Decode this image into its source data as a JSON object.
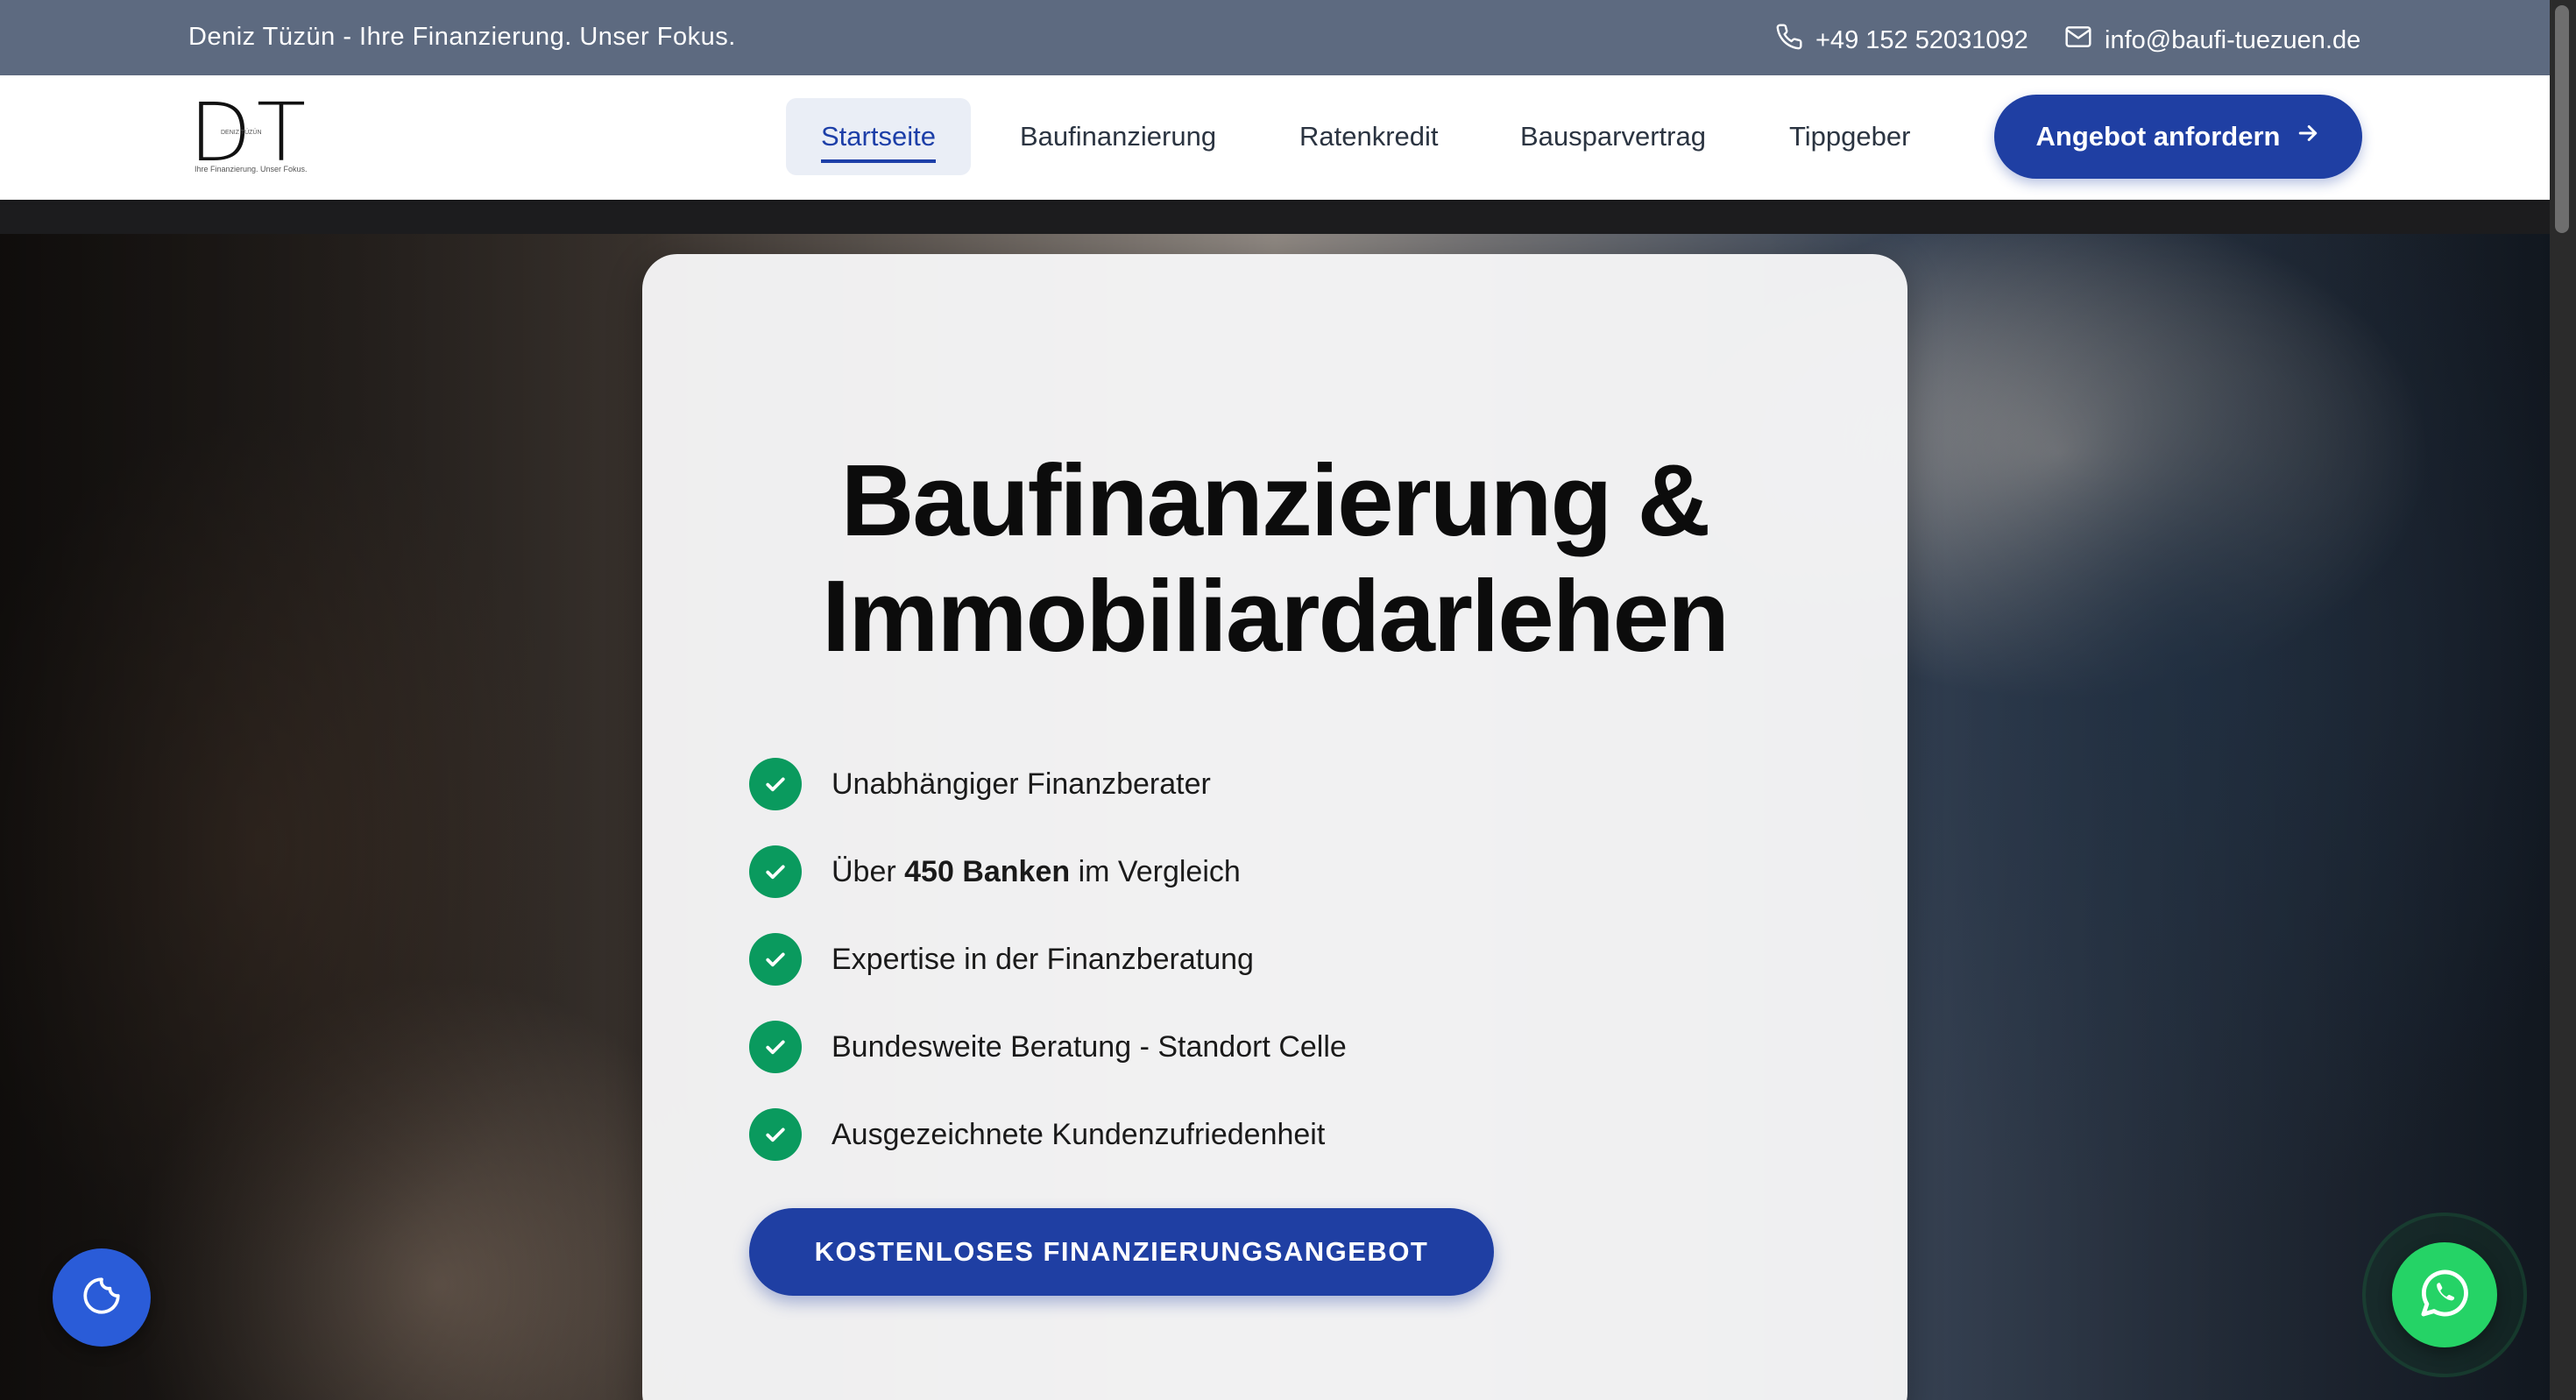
{
  "topbar": {
    "tagline": "Deniz Tüzün - Ihre Finanzierung. Unser Fokus.",
    "phone": "+49 152 52031092",
    "email": "info@baufi-tuezuen.de"
  },
  "logo": {
    "letters": "DT",
    "name": "DENIZ TÜZÜN",
    "subtitle": "Ihre Finanzierung. Unser Fokus."
  },
  "nav": {
    "items": [
      {
        "label": "Startseite",
        "active": true
      },
      {
        "label": "Baufinanzierung",
        "active": false
      },
      {
        "label": "Ratenkredit",
        "active": false
      },
      {
        "label": "Bausparvertrag",
        "active": false
      },
      {
        "label": "Tippgeber",
        "active": false
      }
    ],
    "cta": "Angebot anfordern"
  },
  "hero": {
    "headline_line1": "Baufinanzierung &",
    "headline_line2": "Immobiliardarlehen",
    "features": [
      {
        "text": "Unabhängiger Finanzberater"
      },
      {
        "pre": "Über ",
        "bold": "450 Banken",
        "post": " im Vergleich"
      },
      {
        "text": "Expertise in der Finanzberatung"
      },
      {
        "text": "Bundesweite Beratung - Standort Celle"
      },
      {
        "text": "Ausgezeichnete Kundenzufriedenheit"
      }
    ],
    "cta": "KOSTENLOSES FINANZIERUNGSANGEBOT"
  },
  "floating": {
    "cookie_icon": "cookie-icon",
    "whatsapp_icon": "whatsapp-icon"
  },
  "colors": {
    "topbar": "#5d6a80",
    "accent": "#1f3fa3",
    "check": "#0a9a5e",
    "whatsapp": "#25d366"
  }
}
